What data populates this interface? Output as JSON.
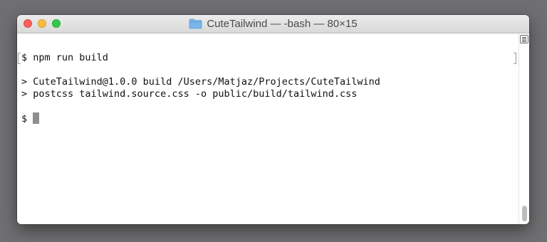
{
  "window": {
    "title": "CuteTailwind — -bash — 80×15",
    "folder_icon": "folder-icon"
  },
  "terminal": {
    "lines": [
      "$ npm run build",
      "",
      "> CuteTailwind@1.0.0 build /Users/Matjaz/Projects/CuteTailwind",
      "> postcss tailwind.source.css -o public/build/tailwind.css",
      "",
      "$ "
    ]
  },
  "colors": {
    "close": "#fc605c",
    "minimize": "#fdbc40",
    "zoom": "#34c84a",
    "cursor": "#8e8e8e",
    "desktop": "#6f6f71"
  },
  "icons": {
    "marks": "list-icon"
  }
}
